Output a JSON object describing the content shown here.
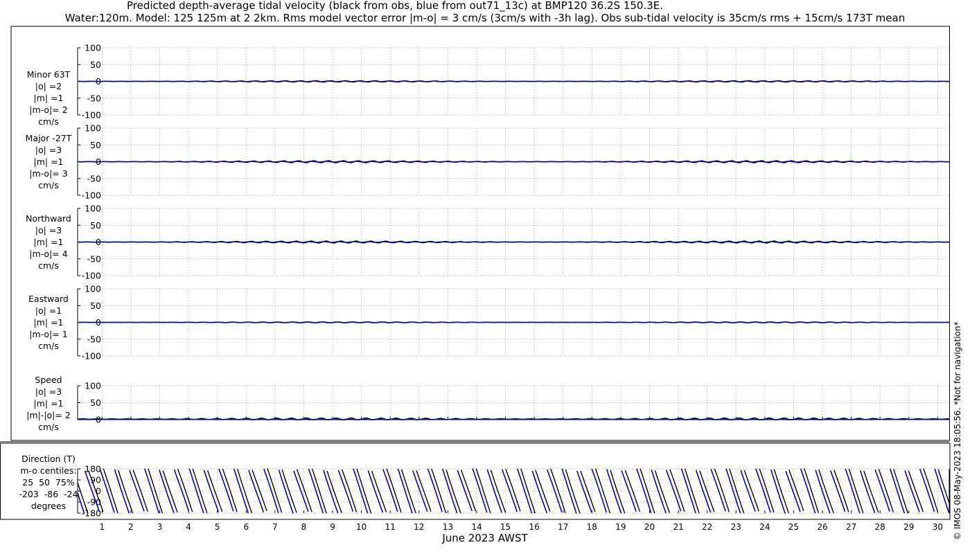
{
  "chart_data": {
    "type": "line",
    "title": "Predicted depth-average tidal velocity (black from obs, blue from out71_13c) at BMP120 36.2S 150.3E.",
    "subtitle": "Water:120m. Model: 125 125m at 2 2km. Rms model vector error |m-o| = 3 cm/s (3cm/s with -3h lag). Obs sub-tidal velocity is 35cm/s rms + 15cm/s 173T mean",
    "xlabel": "June 2023 AWST",
    "x_ticks": [
      "1",
      "2",
      "3",
      "4",
      "5",
      "6",
      "7",
      "8",
      "9",
      "10",
      "11",
      "12",
      "13",
      "14",
      "15",
      "16",
      "17",
      "18",
      "19",
      "20",
      "21",
      "22",
      "23",
      "24",
      "25",
      "26",
      "27",
      "28",
      "29",
      "30"
    ],
    "xlim": [
      0.15,
      30.4
    ],
    "colors": {
      "obs": "#000000",
      "model": "#0000cc",
      "grid": "#b4b4b4"
    },
    "panels": [
      {
        "id": "minor",
        "label_lines": [
          "Minor 63T",
          "|o| =2",
          "|m| =1",
          "|m-o|= 2",
          "cm/s"
        ],
        "ylim": [
          -100,
          100
        ],
        "yticks": [
          "100",
          "50",
          "0",
          "-50",
          "-100"
        ],
        "series": [
          {
            "name": "obs",
            "amplitude": 2,
            "mean": 0
          },
          {
            "name": "model",
            "amplitude": 1,
            "mean": 0
          }
        ]
      },
      {
        "id": "major",
        "label_lines": [
          "Major -27T",
          "|o| =3",
          "|m| =1",
          "|m-o|= 3",
          "cm/s"
        ],
        "ylim": [
          -100,
          100
        ],
        "yticks": [
          "100",
          "50",
          "0",
          "-50",
          "-100"
        ],
        "series": [
          {
            "name": "obs",
            "amplitude": 3,
            "mean": 0
          },
          {
            "name": "model",
            "amplitude": 1,
            "mean": 0
          }
        ]
      },
      {
        "id": "northward",
        "label_lines": [
          "Northward",
          "|o| =3",
          "|m| =1",
          "|m-o|= 4",
          "cm/s"
        ],
        "ylim": [
          -100,
          100
        ],
        "yticks": [
          "100",
          "50",
          "0",
          "-50",
          "-100"
        ],
        "series": [
          {
            "name": "obs",
            "amplitude": 3,
            "mean": 0
          },
          {
            "name": "model",
            "amplitude": 1,
            "mean": 0
          }
        ]
      },
      {
        "id": "eastward",
        "label_lines": [
          "Eastward",
          "|o| =1",
          "|m| =1",
          "|m-o|= 1",
          "cm/s"
        ],
        "ylim": [
          -100,
          100
        ],
        "yticks": [
          "100",
          "50",
          "0",
          "-50",
          "-100"
        ],
        "series": [
          {
            "name": "obs",
            "amplitude": 1,
            "mean": 0
          },
          {
            "name": "model",
            "amplitude": 1,
            "mean": 0
          }
        ]
      },
      {
        "id": "speed",
        "label_lines": [
          "Speed",
          "|o| =3",
          "|m| =1",
          "|m|-|o|= 2",
          "cm/s"
        ],
        "ylim": [
          0,
          100
        ],
        "yticks": [
          "100",
          "50",
          "0"
        ],
        "series": [
          {
            "name": "obs",
            "amplitude": 3,
            "mean": 2
          },
          {
            "name": "model",
            "amplitude": 1,
            "mean": 1
          }
        ]
      },
      {
        "id": "direction",
        "label_lines": [
          "Direction (T)",
          "m-o centiles:",
          "25  50  75%",
          "-203  -86  -24",
          "degrees"
        ],
        "ylim": [
          -180,
          180
        ],
        "yticks": [
          "180",
          "90",
          "0",
          "-90",
          "-180"
        ],
        "series": [
          {
            "name": "obs",
            "phase_deg": 0
          },
          {
            "name": "model",
            "phase_deg": -86
          }
        ]
      }
    ]
  },
  "copyright": "© IMOS 08-May-2023 18:05:56.  *Not for navigation*"
}
